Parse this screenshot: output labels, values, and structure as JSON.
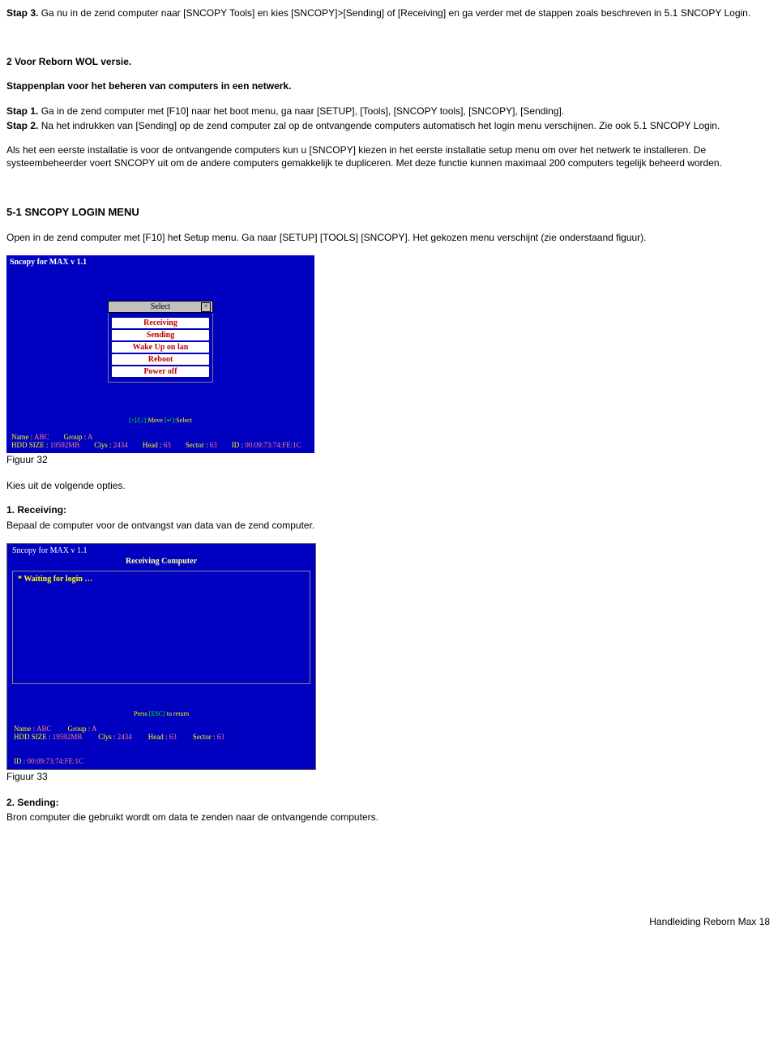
{
  "step3": {
    "label": "Stap 3.",
    "text": " Ga nu in de zend computer naar [SNCOPY Tools] en kies [SNCOPY]>[Sending] of [Receiving] en ga verder met de stappen zoals beschreven in 5.1 SNCOPY Login."
  },
  "section2": {
    "heading": "2 Voor Reborn WOL versie.",
    "subheading": "Stappenplan voor het beheren van computers in een netwerk.",
    "step1_label": "Stap 1.",
    "step1_text": " Ga in de zend computer met [F10] naar het boot menu, ga naar [SETUP], [Tools], [SNCOPY tools], [SNCOPY], [Sending].",
    "step2_label": "Stap 2.",
    "step2_text": " Na het indrukken van [Sending] op de zend computer zal op de ontvangende computers automatisch het login menu verschijnen. Zie ook 5.1 SNCOPY Login.",
    "para2": "Als het een eerste installatie is voor de ontvangende computers kun u [SNCOPY] kiezen in het eerste installatie setup menu om over het netwerk te installeren. De systeembeheerder voert SNCOPY uit om de andere computers gemakkelijk te dupliceren. Met deze functie kunnen maximaal 200 computers tegelijk beheerd worden."
  },
  "section5_1": {
    "heading": "5-1 SNCOPY LOGIN MENU",
    "intro": "Open in de zend computer met [F10] het Setup menu. Ga naar [SETUP] [TOOLS] [SNCOPY]. Het gekozen menu verschijnt (zie onderstaand figuur)."
  },
  "fig32": {
    "app_title": "Sncopy for MAX v 1.1",
    "select_title": "Select",
    "items": [
      "Receiving",
      "Sending",
      "Wake Up on lan",
      "Reboot",
      "Power off"
    ],
    "hint_prefix": "[↑]/[↓]:",
    "hint_mid": "Move  ",
    "hint_esc": "[↵]:",
    "hint_end": "Select",
    "row1": {
      "name_l": "Name :",
      "name_v": "ABC",
      "group_l": "Group :",
      "group_v": "A"
    },
    "row2": {
      "hdd_l": "HDD SIZE :",
      "hdd_v": "19592MB",
      "clys_l": "Clys :",
      "clys_v": "2434",
      "head_l": "Head :",
      "head_v": "63",
      "sector_l": "Sector :",
      "sector_v": "63",
      "id_l": "ID :",
      "id_v": "00:09:73:74:FE:1C"
    },
    "caption": "Figuur 32"
  },
  "options": {
    "intro": "Kies uit de volgende opties.",
    "opt1_label": "1. Receiving:",
    "opt1_text": "Bepaal de computer voor de ontvangst van data van de zend computer."
  },
  "fig33": {
    "app_title": "Sncopy for MAX v 1.1",
    "subtitle": "Receiving  Computer",
    "waiting": "* Waiting  for   login …",
    "hint_press": "Press ",
    "hint_esc": "[ESC]",
    "hint_end": " to return",
    "row1": {
      "name_l": "Name :",
      "name_v": "ABC",
      "group_l": "Group :",
      "group_v": "A"
    },
    "row2": {
      "hdd_l": "HDD SIZE :",
      "hdd_v": "19592MB",
      "clys_l": "Clys :",
      "clys_v": "2434",
      "head_l": "Head :",
      "head_v": "63",
      "sector_l": "Sector :",
      "sector_v": "63",
      "id_l": "ID :",
      "id_v": "00:09:73:74:FE:1C"
    },
    "caption": "Figuur 33"
  },
  "opt2": {
    "label": "2. Sending:",
    "text": "Bron computer die gebruikt wordt om data te zenden naar de ontvangende computers."
  },
  "footer": "Handleiding Reborn Max 18"
}
